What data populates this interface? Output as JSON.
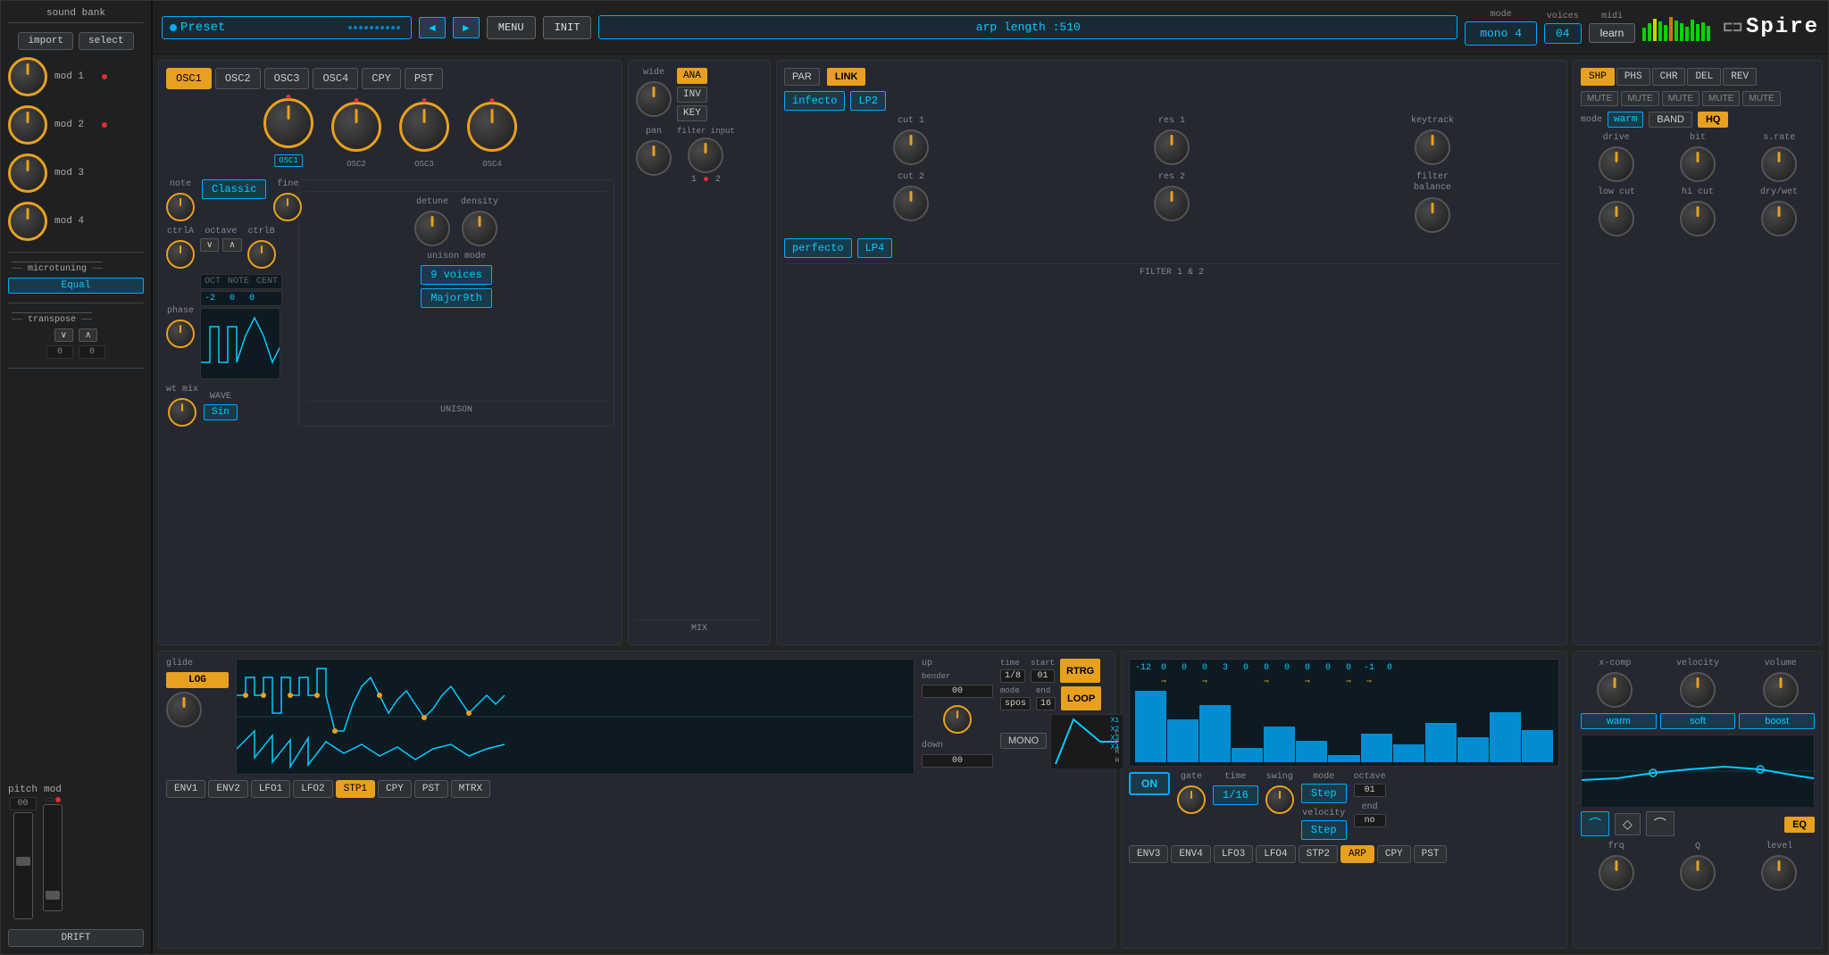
{
  "sidebar": {
    "title": "sound bank",
    "import_label": "import",
    "select_label": "select",
    "mods": [
      {
        "label": "mod 1"
      },
      {
        "label": "mod 2"
      },
      {
        "label": "mod 3"
      },
      {
        "label": "mod 4"
      }
    ],
    "microtuning_label": "microtuning",
    "microtuning_value": "Equal",
    "transpose_label": "transpose",
    "transpose_down_val": "0",
    "transpose_up_val": "0",
    "pitch_label": "pitch",
    "mod_label": "mod"
  },
  "top_bar": {
    "preset_label": "Preset",
    "menu_label": "MENU",
    "init_label": "INIT",
    "arp_display": "arp length :510",
    "mode_label": "mode",
    "mode_value": "mono 4",
    "voices_label": "voices",
    "voices_value": "04",
    "midi_label": "midi",
    "learn_label": "learn",
    "logo": "Spire",
    "nav_prev": "◄",
    "nav_next": "►"
  },
  "osc": {
    "tabs": [
      "OSC1",
      "OSC2",
      "OSC3",
      "OSC4",
      "CPY",
      "PST"
    ],
    "active_tab": "OSC1",
    "note_label": "note",
    "fine_label": "fine",
    "ctrla_label": "ctrlA",
    "ctrlb_label": "ctrlB",
    "octave_label": "octave",
    "wt_mix_label": "wt mix",
    "classic_value": "Classic",
    "wave_value": "WAVE",
    "sin_value": "Sin",
    "oct_val": "-2",
    "note_val": "0",
    "cent_val": "0",
    "knobs": [
      "OSC1",
      "OSC2",
      "OSC3",
      "OSC4"
    ],
    "section_label": "WAVE"
  },
  "unison": {
    "detune_label": "detune",
    "density_label": "density",
    "mode_label": "unison mode",
    "mode_value": "9 voices",
    "chord_value": "Major9th",
    "section_label": "UNISON"
  },
  "mix": {
    "wide_label": "wide",
    "pan_label": "pan",
    "filter_input_label": "filter input",
    "ana_label": "ANA",
    "inv_label": "INV",
    "key_label": "KEY",
    "mix_label_1": "1",
    "mix_label_2": "2",
    "section_label": "MIX"
  },
  "filter": {
    "par_label": "PAR",
    "link_label": "LINK",
    "infecto_value": "infecto",
    "lp2_value": "LP2",
    "cut1_label": "cut 1",
    "res1_label": "res 1",
    "keytrack_label": "keytrack",
    "cut2_label": "cut 2",
    "res2_label": "res 2",
    "filter_balance_label": "filter balance",
    "perfecto_value": "perfecto",
    "lp4_value": "LP4",
    "section_label": "FILTER 1 & 2"
  },
  "fx": {
    "tabs": [
      "SHP",
      "PHS",
      "CHR",
      "DEL",
      "REV"
    ],
    "active_tab": "SHP",
    "mute_labels": [
      "MUTE",
      "MUTE",
      "MUTE",
      "MUTE",
      "MUTE"
    ],
    "mode_label": "mode",
    "warm_value": "warm",
    "band_label": "BAND",
    "hq_label": "HQ",
    "drive_label": "drive",
    "bit_label": "bit",
    "srate_label": "s.rate",
    "low_cut_label": "low cut",
    "hi_cut_label": "hi cut",
    "dry_wet_label": "dry/wet"
  },
  "env_lfo": {
    "glide_label": "glide",
    "log_label": "LOG",
    "bender_up_label": "up",
    "bender_down_label": "down",
    "bender_up_val": "00",
    "bender_down_val": "00",
    "time_label": "time",
    "time_value": "1/8",
    "start_label": "start",
    "start_value": "01",
    "mode_label": "mode",
    "mode_value": "spos",
    "end_label": "end",
    "end_value": "16",
    "rtrg_label": "RTRG",
    "loop_label": "LOOP",
    "mono_label": "MONO",
    "bender_label": "bender",
    "x1_label": "X1",
    "x2_label": "X2",
    "x3_label": "X3",
    "x4_label": "X4",
    "c_label": "C",
    "p_label": "P",
    "r_label": "R",
    "h_label": "H",
    "tabs": [
      "ENV1",
      "ENV2",
      "LFO1",
      "LFO2",
      "STP1",
      "CPY",
      "PST",
      "MTRX"
    ],
    "active_tab": "STP1"
  },
  "arp": {
    "on_label": "ON",
    "gate_label": "gate",
    "time_label": "time",
    "time_value": "1/16",
    "swing_label": "swing",
    "mode_label": "mode",
    "mode_value": "Step",
    "octave_label": "octave",
    "octave_value": "01",
    "velocity_label": "velocity",
    "velocity_value": "Step",
    "end_label": "end",
    "end_value": "no",
    "tabs": [
      "ENV3",
      "ENV4",
      "LFO3",
      "LFO4",
      "STP2",
      "ARP",
      "CPY",
      "PST"
    ],
    "active_tab": "ARP",
    "step_values": [
      "-12",
      "0",
      "0",
      "0",
      "3",
      "0",
      "0",
      "0",
      "0",
      "0",
      "0",
      "-1",
      "0"
    ]
  },
  "master": {
    "x_comp_label": "x-comp",
    "velocity_label": "velocity",
    "volume_label": "volume",
    "warm_label": "warm",
    "soft_label": "soft",
    "boost_label": "boost",
    "frq_label": "frq",
    "q_label": "Q",
    "level_label": "level",
    "eq_label": "EQ"
  }
}
